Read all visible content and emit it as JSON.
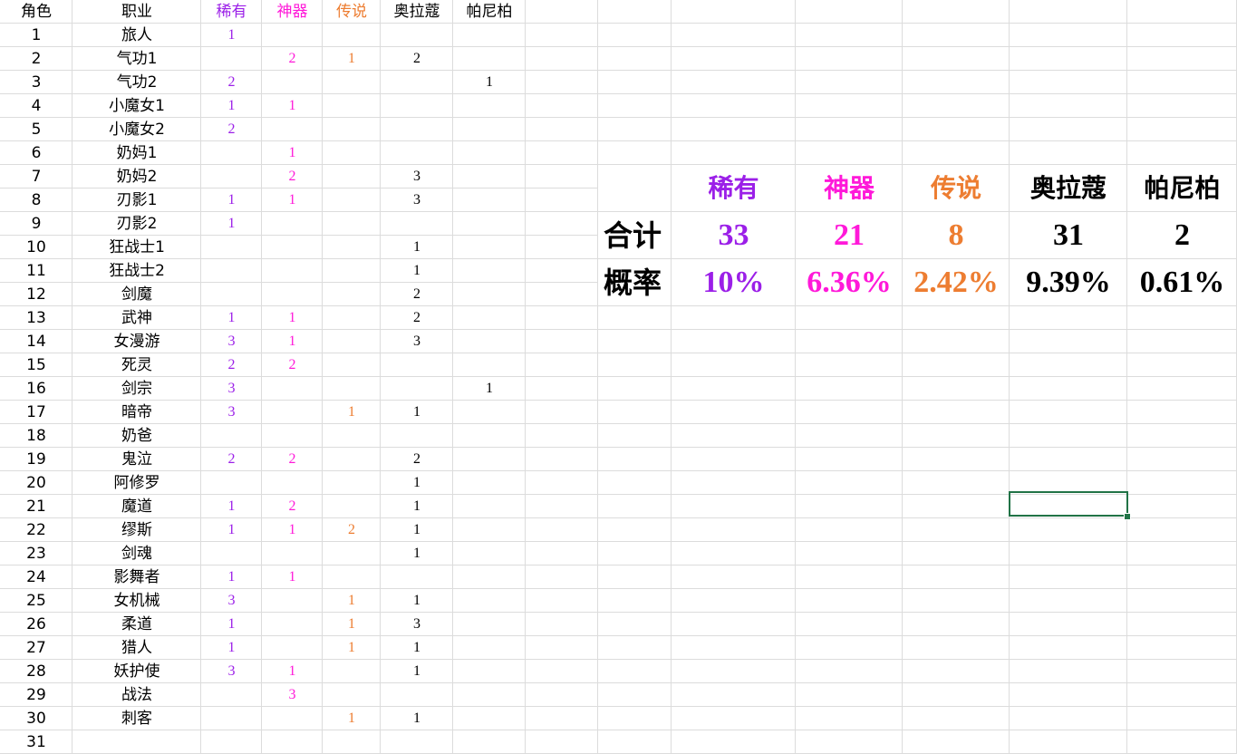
{
  "colors": {
    "rare": "#9b1fe8",
    "artifact": "#ff19d9",
    "legendary": "#ed7d31",
    "black": "#000000",
    "selection": "#217346"
  },
  "headers": {
    "role": "角色",
    "job": "职业",
    "rare": "稀有",
    "artifact": "神器",
    "legendary": "传说",
    "olakou": "奥拉蔻",
    "panibo": "帕尼柏"
  },
  "rows": [
    {
      "n": "1",
      "job": "旅人",
      "rare": "1",
      "artifact": "",
      "legendary": "",
      "olakou": "",
      "panibo": ""
    },
    {
      "n": "2",
      "job": "气功1",
      "rare": "",
      "artifact": "2",
      "legendary": "1",
      "olakou": "2",
      "panibo": ""
    },
    {
      "n": "3",
      "job": "气功2",
      "rare": "2",
      "artifact": "",
      "legendary": "",
      "olakou": "",
      "panibo": "1"
    },
    {
      "n": "4",
      "job": "小魔女1",
      "rare": "1",
      "artifact": "1",
      "legendary": "",
      "olakou": "",
      "panibo": ""
    },
    {
      "n": "5",
      "job": "小魔女2",
      "rare": "2",
      "artifact": "",
      "legendary": "",
      "olakou": "",
      "panibo": ""
    },
    {
      "n": "6",
      "job": "奶妈1",
      "rare": "",
      "artifact": "1",
      "legendary": "",
      "olakou": "",
      "panibo": ""
    },
    {
      "n": "7",
      "job": "奶妈2",
      "rare": "",
      "artifact": "2",
      "legendary": "",
      "olakou": "3",
      "panibo": ""
    },
    {
      "n": "8",
      "job": "刃影1",
      "rare": "1",
      "artifact": "1",
      "legendary": "",
      "olakou": "3",
      "panibo": ""
    },
    {
      "n": "9",
      "job": "刃影2",
      "rare": "1",
      "artifact": "",
      "legendary": "",
      "olakou": "",
      "panibo": ""
    },
    {
      "n": "10",
      "job": "狂战士1",
      "rare": "",
      "artifact": "",
      "legendary": "",
      "olakou": "1",
      "panibo": ""
    },
    {
      "n": "11",
      "job": "狂战士2",
      "rare": "",
      "artifact": "",
      "legendary": "",
      "olakou": "1",
      "panibo": ""
    },
    {
      "n": "12",
      "job": "剑魔",
      "rare": "",
      "artifact": "",
      "legendary": "",
      "olakou": "2",
      "panibo": ""
    },
    {
      "n": "13",
      "job": "武神",
      "rare": "1",
      "artifact": "1",
      "legendary": "",
      "olakou": "2",
      "panibo": ""
    },
    {
      "n": "14",
      "job": "女漫游",
      "rare": "3",
      "artifact": "1",
      "legendary": "",
      "olakou": "3",
      "panibo": ""
    },
    {
      "n": "15",
      "job": "死灵",
      "rare": "2",
      "artifact": "2",
      "legendary": "",
      "olakou": "",
      "panibo": ""
    },
    {
      "n": "16",
      "job": "剑宗",
      "rare": "3",
      "artifact": "",
      "legendary": "",
      "olakou": "",
      "panibo": "1"
    },
    {
      "n": "17",
      "job": "暗帝",
      "rare": "3",
      "artifact": "",
      "legendary": "1",
      "olakou": "1",
      "panibo": ""
    },
    {
      "n": "18",
      "job": "奶爸",
      "rare": "",
      "artifact": "",
      "legendary": "",
      "olakou": "",
      "panibo": ""
    },
    {
      "n": "19",
      "job": "鬼泣",
      "rare": "2",
      "artifact": "2",
      "legendary": "",
      "olakou": "2",
      "panibo": ""
    },
    {
      "n": "20",
      "job": "阿修罗",
      "rare": "",
      "artifact": "",
      "legendary": "",
      "olakou": "1",
      "panibo": ""
    },
    {
      "n": "21",
      "job": "魔道",
      "rare": "1",
      "artifact": "2",
      "legendary": "",
      "olakou": "1",
      "panibo": ""
    },
    {
      "n": "22",
      "job": "缪斯",
      "rare": "1",
      "artifact": "1",
      "legendary": "2",
      "olakou": "1",
      "panibo": ""
    },
    {
      "n": "23",
      "job": "剑魂",
      "rare": "",
      "artifact": "",
      "legendary": "",
      "olakou": "1",
      "panibo": ""
    },
    {
      "n": "24",
      "job": "影舞者",
      "rare": "1",
      "artifact": "1",
      "legendary": "",
      "olakou": "",
      "panibo": ""
    },
    {
      "n": "25",
      "job": "女机械",
      "rare": "3",
      "artifact": "",
      "legendary": "1",
      "olakou": "1",
      "panibo": ""
    },
    {
      "n": "26",
      "job": "柔道",
      "rare": "1",
      "artifact": "",
      "legendary": "1",
      "olakou": "3",
      "panibo": ""
    },
    {
      "n": "27",
      "job": "猎人",
      "rare": "1",
      "artifact": "",
      "legendary": "1",
      "olakou": "1",
      "panibo": ""
    },
    {
      "n": "28",
      "job": "妖护使",
      "rare": "3",
      "artifact": "1",
      "legendary": "",
      "olakou": "1",
      "panibo": ""
    },
    {
      "n": "29",
      "job": "战法",
      "rare": "",
      "artifact": "3",
      "legendary": "",
      "olakou": "",
      "panibo": ""
    },
    {
      "n": "30",
      "job": "刺客",
      "rare": "",
      "artifact": "",
      "legendary": "1",
      "olakou": "1",
      "panibo": ""
    },
    {
      "n": "31",
      "job": "",
      "rare": "",
      "artifact": "",
      "legendary": "",
      "olakou": "",
      "panibo": ""
    }
  ],
  "summary": {
    "headers": {
      "rare": "稀有",
      "artifact": "神器",
      "legendary": "传说",
      "olakou": "奥拉蔻",
      "panibo": "帕尼柏"
    },
    "total_label": "合计",
    "prob_label": "概率",
    "totals": {
      "rare": "33",
      "artifact": "21",
      "legendary": "8",
      "olakou": "31",
      "panibo": "2"
    },
    "probs": {
      "rare": "10%",
      "artifact": "6.36%",
      "legendary": "2.42%",
      "olakou": "9.39%",
      "panibo": "0.61%"
    }
  }
}
